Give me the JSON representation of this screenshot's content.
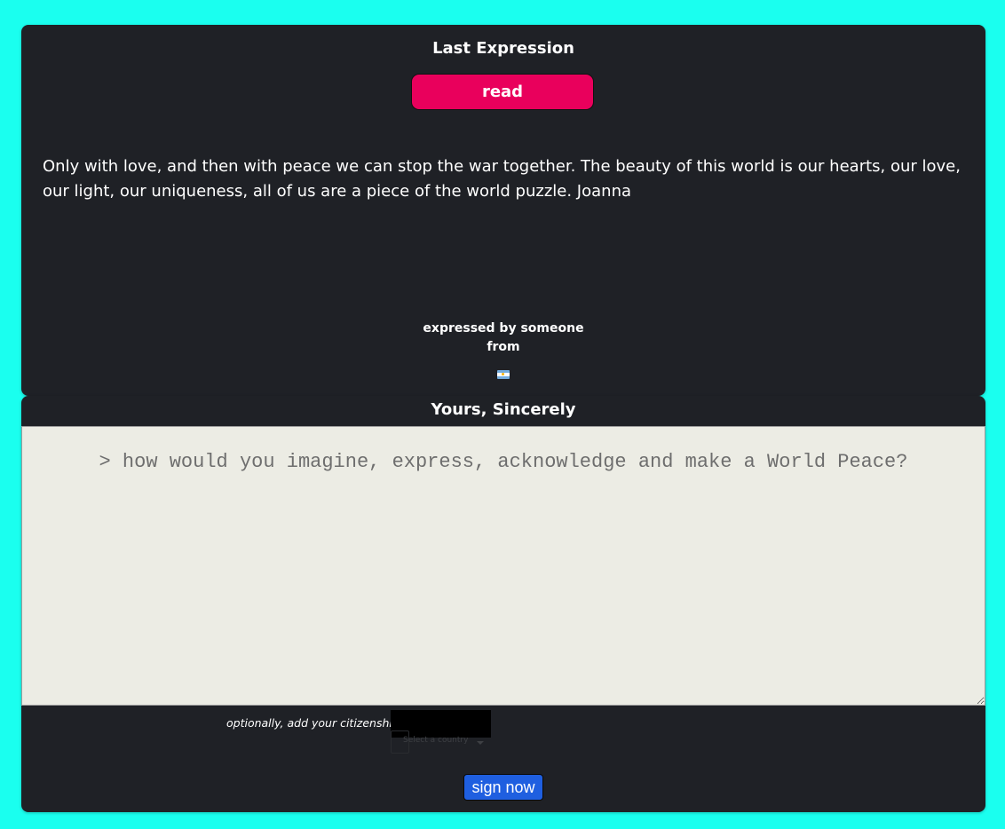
{
  "last_expression": {
    "title": "Last Expression",
    "read_button": "read",
    "message": "Only with love, and then with peace we can stop the war together. The beauty of this world is our hearts, our love, our light, our uniqueness, all of us are a piece of the world puzzle. Joanna",
    "expressed_by": "expressed by someone",
    "from": "from",
    "flag_icon": "argentina-flag-icon"
  },
  "form": {
    "title": "Yours, Sincerely",
    "placeholder": "> how would you imagine, express, acknowledge and make a World Peace?",
    "value": "",
    "citizenship_label": "optionally, add your citizenship",
    "country_placeholder": "Select a country",
    "sign_button": "sign now"
  },
  "colors": {
    "background": "#1affef",
    "card": "#1f2126",
    "read_button": "#e9005c",
    "sign_button": "#1f5fe0",
    "input_background": "#ecece4"
  }
}
